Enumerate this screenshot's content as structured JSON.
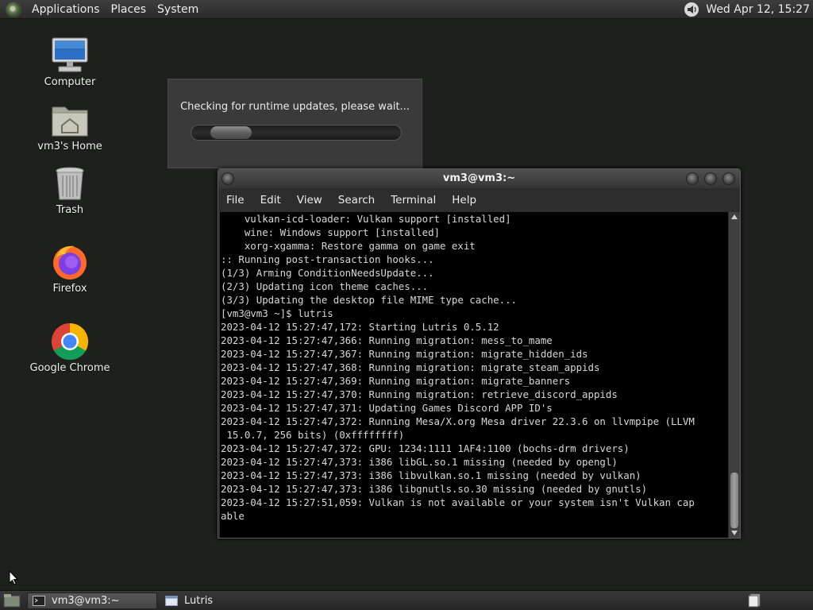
{
  "top_panel": {
    "menus": [
      "Applications",
      "Places",
      "System"
    ],
    "clock": "Wed Apr 12, 15:27"
  },
  "desktop_icons": [
    {
      "label": "Computer",
      "icon": "computer-icon"
    },
    {
      "label": "vm3's Home",
      "icon": "home-folder-icon"
    },
    {
      "label": "Trash",
      "icon": "trash-icon"
    },
    {
      "label": "Firefox",
      "icon": "firefox-icon"
    },
    {
      "label": "Google Chrome",
      "icon": "chrome-icon"
    }
  ],
  "lutris_dialog": {
    "message": "Checking for runtime updates, please wait..."
  },
  "terminal": {
    "title": "vm3@vm3:~",
    "menus": [
      "File",
      "Edit",
      "View",
      "Search",
      "Terminal",
      "Help"
    ],
    "lines": [
      "    vulkan-icd-loader: Vulkan support [installed]",
      "    wine: Windows support [installed]",
      "    xorg-xgamma: Restore gamma on game exit",
      ":: Running post-transaction hooks...",
      "(1/3) Arming ConditionNeedsUpdate...",
      "(2/3) Updating icon theme caches...",
      "(3/3) Updating the desktop file MIME type cache...",
      "[vm3@vm3 ~]$ lutris",
      "2023-04-12 15:27:47,172: Starting Lutris 0.5.12",
      "2023-04-12 15:27:47,366: Running migration: mess_to_mame",
      "2023-04-12 15:27:47,367: Running migration: migrate_hidden_ids",
      "2023-04-12 15:27:47,368: Running migration: migrate_steam_appids",
      "2023-04-12 15:27:47,369: Running migration: migrate_banners",
      "2023-04-12 15:27:47,370: Running migration: retrieve_discord_appids",
      "2023-04-12 15:27:47,371: Updating Games Discord APP ID's",
      "2023-04-12 15:27:47,372: Running Mesa/X.org Mesa driver 22.3.6 on llvmpipe (LLVM",
      " 15.0.7, 256 bits) (0xffffffff)",
      "2023-04-12 15:27:47,372: GPU: 1234:1111 1AF4:1100 (bochs-drm drivers)",
      "2023-04-12 15:27:47,373: i386 libGL.so.1 missing (needed by opengl)",
      "2023-04-12 15:27:47,373: i386 libvulkan.so.1 missing (needed by vulkan)",
      "2023-04-12 15:27:47,373: i386 libgnutls.so.30 missing (needed by gnutls)",
      "2023-04-12 15:27:51,059: Vulkan is not available or your system isn't Vulkan cap",
      "able"
    ]
  },
  "taskbar": {
    "tasks": [
      {
        "label": "vm3@vm3:~",
        "icon": "terminal-icon",
        "active": true
      },
      {
        "label": "Lutris",
        "icon": "window-icon",
        "active": false
      }
    ]
  }
}
